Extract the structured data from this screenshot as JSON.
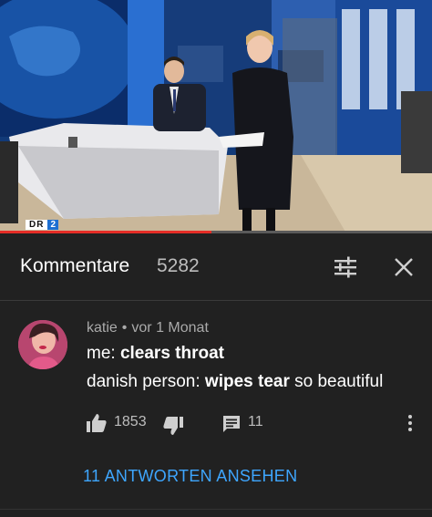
{
  "video": {
    "channel_logo": "DR",
    "channel_number": "2",
    "progress": 0.49
  },
  "header": {
    "title": "Kommentare",
    "count": "5282",
    "filter_icon": "filter-sliders-icon",
    "close_icon": "close-icon"
  },
  "comment": {
    "author": "katie",
    "separator": "•",
    "time": "vor 1 Monat",
    "line1_prefix": "me: ",
    "line1_bold": "clears throat",
    "line2_prefix": "danish person: ",
    "line2_bold": "wipes tear",
    "line2_suffix": " so beautiful",
    "likes": "1853",
    "replies": "11",
    "view_replies": "11 ANTWORTEN ANSEHEN"
  },
  "colors": {
    "background": "#212121",
    "link": "#3ea6ff",
    "progress": "#e52d27"
  }
}
